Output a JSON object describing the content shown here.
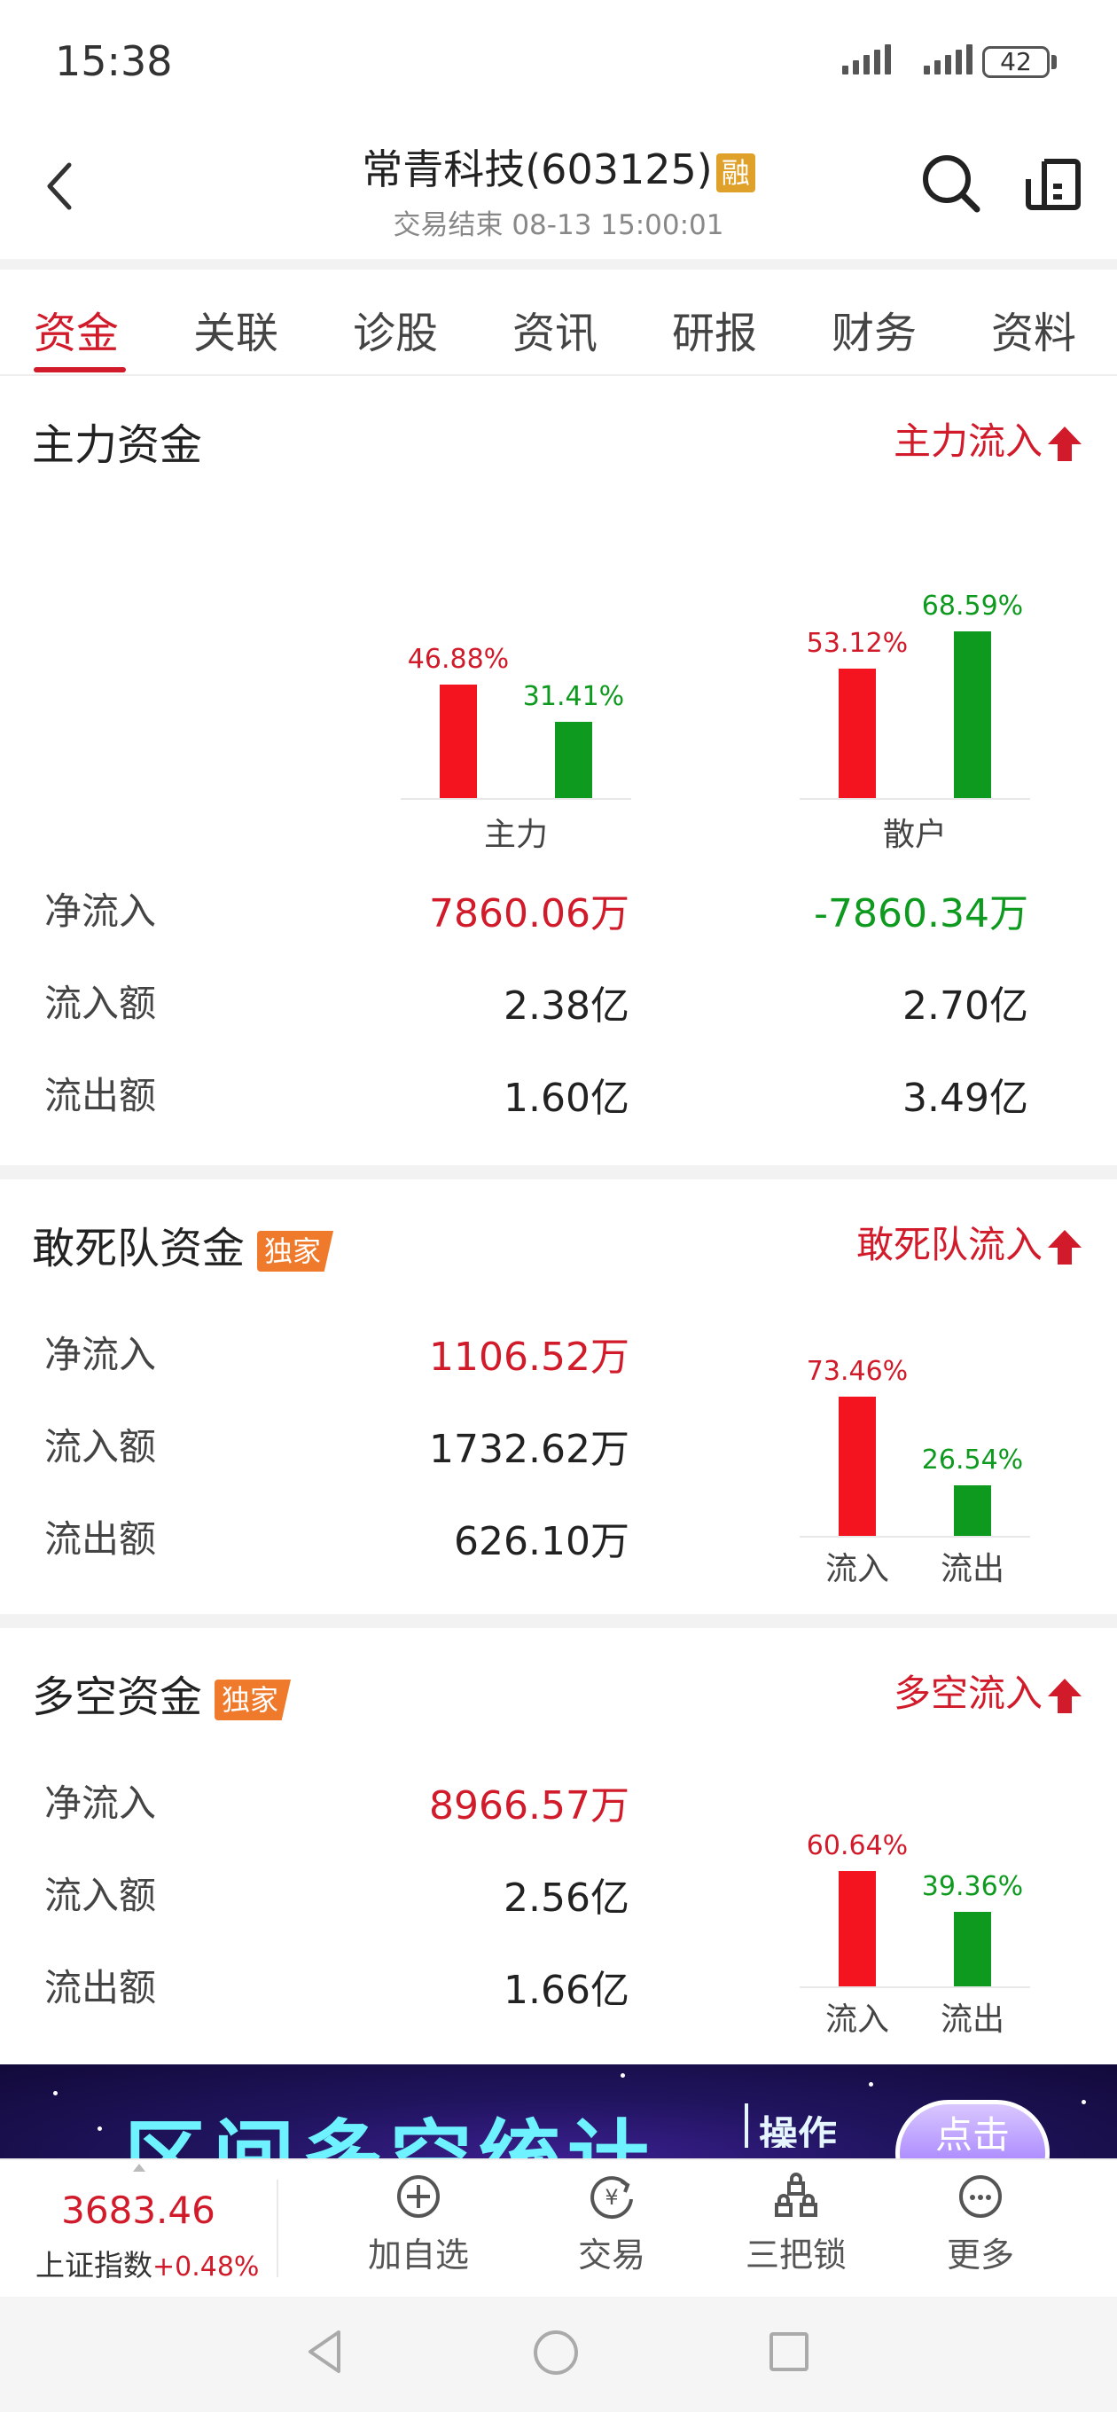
{
  "status_bar": {
    "time": "15:38",
    "battery": "42"
  },
  "header": {
    "title": "常青科技(603125)",
    "margin_badge": "融",
    "subtitle": "交易结束 08-13 15:00:01",
    "icons": [
      "back-icon",
      "search-icon",
      "share-icon"
    ]
  },
  "tabs": [
    {
      "label": "资金",
      "active": true
    },
    {
      "label": "关联"
    },
    {
      "label": "诊股"
    },
    {
      "label": "资讯"
    },
    {
      "label": "研报"
    },
    {
      "label": "财务"
    },
    {
      "label": "资料"
    }
  ],
  "main_funds": {
    "title": "主力资金",
    "status": "主力流入",
    "chart": {
      "groups": [
        {
          "label": "主力",
          "inflow_pct": "46.88%",
          "outflow_pct": "31.41%",
          "inflow": 46.88,
          "outflow": 31.41
        },
        {
          "label": "散户",
          "inflow_pct": "53.12%",
          "outflow_pct": "68.59%",
          "inflow": 53.12,
          "outflow": 68.59
        }
      ]
    },
    "rows": [
      {
        "label": "净流入",
        "main": "7860.06万",
        "retail": "-7860.34万"
      },
      {
        "label": "流入额",
        "main": "2.38亿",
        "retail": "2.70亿"
      },
      {
        "label": "流出额",
        "main": "1.60亿",
        "retail": "3.49亿"
      }
    ]
  },
  "dare_funds": {
    "title": "敢死队资金",
    "badge": "独家",
    "status": "敢死队流入",
    "rows": [
      {
        "label": "净流入",
        "value": "1106.52万"
      },
      {
        "label": "流入额",
        "value": "1732.62万"
      },
      {
        "label": "流出额",
        "value": "626.10万"
      }
    ],
    "chart": {
      "inflow_pct": "73.46%",
      "outflow_pct": "26.54%",
      "inflow": 73.46,
      "outflow": 26.54,
      "inflow_label": "流入",
      "outflow_label": "流出"
    }
  },
  "longshort_funds": {
    "title": "多空资金",
    "badge": "独家",
    "status": "多空流入",
    "rows": [
      {
        "label": "净流入",
        "value": "8966.57万"
      },
      {
        "label": "流入额",
        "value": "2.56亿"
      },
      {
        "label": "流出额",
        "value": "1.66亿"
      }
    ],
    "chart": {
      "inflow_pct": "60.64%",
      "outflow_pct": "39.36%",
      "inflow": 60.64,
      "outflow": 39.36,
      "inflow_label": "流入",
      "outflow_label": "流出"
    }
  },
  "banner": {
    "text": "区间多空统计",
    "tag": "操作",
    "button": "点击"
  },
  "bottom_bar": {
    "index_value": "3683.46",
    "index_name": "上证指数",
    "index_change": "+0.48%",
    "items": [
      {
        "label": "加自选",
        "icon": "add-circle-icon"
      },
      {
        "label": "交易",
        "icon": "yen-exchange-icon"
      },
      {
        "label": "三把锁",
        "icon": "locks-icon"
      },
      {
        "label": "更多",
        "icon": "more-icon"
      }
    ]
  },
  "colors": {
    "red": "#d11a2a",
    "green": "#0d9a1e",
    "bar_red": "#f4141f",
    "badge_orange": "#f07a2c",
    "margin_badge": "#e0a12a"
  }
}
